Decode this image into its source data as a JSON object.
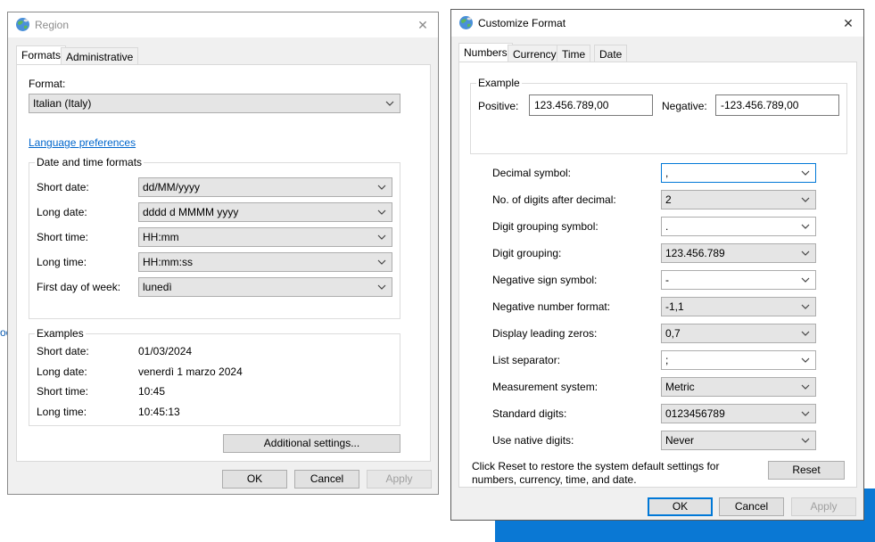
{
  "region": {
    "title": "Region",
    "tabs": [
      "Formats",
      "Administrative"
    ],
    "format_label": "Format:",
    "format_value": "Italian (Italy)",
    "language_link": "Language preferences",
    "dt_group": "Date and time formats",
    "short_date_label": "Short date:",
    "short_date_value": "dd/MM/yyyy",
    "long_date_label": "Long date:",
    "long_date_value": "dddd d MMMM yyyy",
    "short_time_label": "Short time:",
    "short_time_value": "HH:mm",
    "long_time_label": "Long time:",
    "long_time_value": "HH:mm:ss",
    "first_day_label": "First day of week:",
    "first_day_value": "lunedì",
    "examples_group": "Examples",
    "ex_short_date_label": "Short date:",
    "ex_short_date_value": "01/03/2024",
    "ex_long_date_label": "Long date:",
    "ex_long_date_value": "venerdì 1 marzo 2024",
    "ex_short_time_label": "Short time:",
    "ex_short_time_value": "10:45",
    "ex_long_time_label": "Long time:",
    "ex_long_time_value": "10:45:13",
    "additional_settings": "Additional settings...",
    "ok": "OK",
    "cancel": "Cancel",
    "apply": "Apply"
  },
  "customize": {
    "title": "Customize Format",
    "tabs": [
      "Numbers",
      "Currency",
      "Time",
      "Date"
    ],
    "example_group": "Example",
    "positive_label": "Positive:",
    "positive_value": "123.456.789,00",
    "negative_label": "Negative:",
    "negative_value": "-123.456.789,00",
    "rows": [
      {
        "label": "Decimal symbol:",
        "value": ","
      },
      {
        "label": "No. of digits after decimal:",
        "value": "2"
      },
      {
        "label": "Digit grouping symbol:",
        "value": "."
      },
      {
        "label": "Digit grouping:",
        "value": "123.456.789"
      },
      {
        "label": "Negative sign symbol:",
        "value": "-"
      },
      {
        "label": "Negative number format:",
        "value": "-1,1"
      },
      {
        "label": "Display leading zeros:",
        "value": "0,7"
      },
      {
        "label": "List separator:",
        "value": ";"
      },
      {
        "label": "Measurement system:",
        "value": "Metric"
      },
      {
        "label": "Standard digits:",
        "value": "0123456789"
      },
      {
        "label": "Use native digits:",
        "value": "Never"
      }
    ],
    "reset_text_line1": "Click Reset to restore the system default settings for",
    "reset_text_line2": "numbers, currency, time, and date.",
    "reset": "Reset",
    "ok": "OK",
    "cancel": "Cancel",
    "apply": "Apply"
  },
  "background": {
    "sliver_text": "oo"
  },
  "colors": {
    "accent": "#0078d7",
    "link": "#0066cc",
    "desktop": "#0a78d4"
  }
}
